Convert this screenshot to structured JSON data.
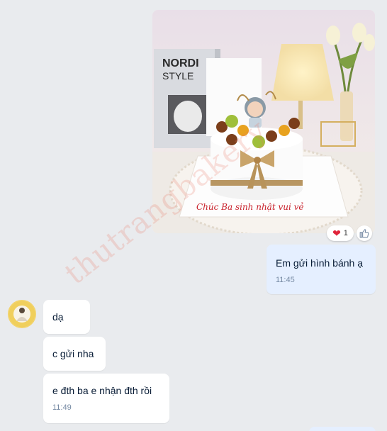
{
  "image_message": {
    "reaction_count": "1",
    "reaction_icon": "heart-icon",
    "like_icon": "thumbs-up-icon",
    "photo_text": {
      "book_title": "NORDI",
      "book_subtitle": "STYLE",
      "cake_inscription": "Chúc Ba sinh nhật vui vẻ"
    }
  },
  "messages": [
    {
      "id": "sent-1",
      "sender": "me",
      "text": "Em gửi hình bánh ạ",
      "time": "11:45"
    },
    {
      "id": "recv-1",
      "sender": "other",
      "text": "dạ"
    },
    {
      "id": "recv-2",
      "sender": "other",
      "text": "c gửi nha"
    },
    {
      "id": "recv-3",
      "sender": "other",
      "text": "e đth ba e nhận đth rồi",
      "time": "11:49"
    }
  ],
  "watermark": "thutrangbakery",
  "colors": {
    "background": "#e9ebee",
    "my_bubble": "#e5efff",
    "their_bubble": "#ffffff",
    "time_text": "#7589a3",
    "heart": "#e0243a"
  }
}
